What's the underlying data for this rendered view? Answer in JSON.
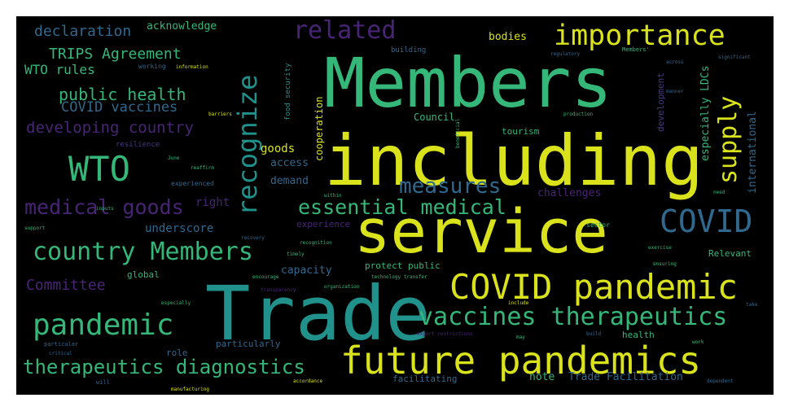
{
  "cloud": {
    "colors": {
      "background": "#000000",
      "yellow": "#d9e21a",
      "green": "#35b779",
      "teal": "#21918c",
      "blue": "#31688e",
      "purple": "#443983",
      "violet": "#482475"
    },
    "words": [
      "Members",
      "including",
      "service",
      "Trade",
      "future pandemics",
      "COVID pandemic",
      "importance",
      "recognize",
      "WTO",
      "COVID",
      "vaccines therapeutics",
      "pandemic",
      "country Members",
      "supply",
      "therapeutics diagnostics",
      "medical goods",
      "essential medical",
      "measures",
      "related",
      "developing country",
      "public health",
      "COVID vaccines",
      "TRIPS Agreement",
      "WTO rules",
      "declaration",
      "acknowledge",
      "Committee",
      "especially LDCs",
      "international",
      "bodies",
      "goods",
      "access",
      "demand",
      "cooperation",
      "food security",
      "challenges",
      "right",
      "underscore",
      "capacity",
      "protect public",
      "Relevant",
      "note",
      "Trade Facilitation",
      "facilitating",
      "Council",
      "tourism",
      "experience",
      "development",
      "global",
      "particularly",
      "role",
      "health",
      "sector",
      "building",
      "working",
      "resilience",
      "experienced",
      "information",
      "barriers",
      "production",
      "regulatory",
      "significant",
      "manner",
      "across",
      "Members'",
      "need",
      "June",
      "reaffirm",
      "inputs",
      "support",
      "recovery",
      "timely",
      "recognition",
      "encourage",
      "transparency",
      "organization",
      "technology transfer",
      "include",
      "export restrictions",
      "may",
      "build",
      "work",
      "dependent",
      "critical",
      "will",
      "accordance",
      "manufacturing",
      "particular",
      "especially",
      "ensuring",
      "exercise",
      "take",
      "within",
      "beneficial"
    ]
  }
}
